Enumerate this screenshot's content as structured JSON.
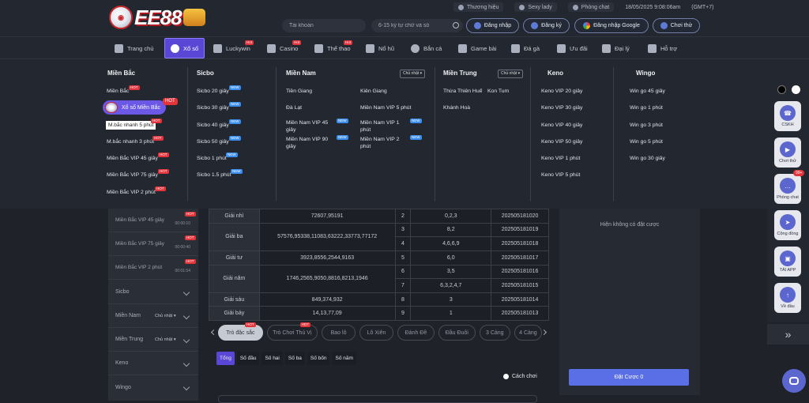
{
  "header": {
    "logo_text": "EE88",
    "top_links": [
      {
        "label": "Thương hiệu",
        "icon": "github-like-icon"
      },
      {
        "label": "Sexy lady",
        "icon": "lady-icon"
      },
      {
        "label": "Phòng chat",
        "icon": "chat-icon"
      }
    ],
    "datetime": "18/05/2025 9:08:06am",
    "timezone": "(GMT+7)",
    "account_placeholder": "Tài khoản",
    "password_placeholder": "6-15 ký tự chữ và số",
    "login_label": "Đăng nhập",
    "register_label": "Đăng ký",
    "google_login_label": "Đăng nhập Google",
    "trial_label": "Chơi thử"
  },
  "nav": {
    "items": [
      {
        "label": "Trang chủ",
        "icon": "home-icon"
      },
      {
        "label": "Xổ số",
        "icon": "lottery-icon"
      },
      {
        "label": "Luckywin",
        "icon": "luckywin-icon",
        "badge": "Hot"
      },
      {
        "label": "Casino",
        "icon": "casino-icon",
        "badge": "Hot"
      },
      {
        "label": "Thể thao",
        "icon": "sports-icon",
        "badge": "Hot"
      },
      {
        "label": "Nổ hũ",
        "icon": "slots-icon"
      },
      {
        "label": "Bắn cá",
        "icon": "fish-icon"
      },
      {
        "label": "Game bài",
        "icon": "cards-icon"
      },
      {
        "label": "Đá gà",
        "icon": "rooster-icon"
      },
      {
        "label": "Ưu đãi",
        "icon": "gift-icon"
      },
      {
        "label": "Đại lý",
        "icon": "agent-icon"
      },
      {
        "label": "Hỗ trợ",
        "icon": "support-icon"
      }
    ]
  },
  "dropdown": {
    "mien_bac": {
      "title": "Miền Bắc",
      "items": [
        "Miền Bắc",
        "Xổ số Miền Bắc",
        "M.bắc nhanh 5 phút",
        "M.bắc nhanh 3 phút",
        "Miền Bắc VIP 45 giây",
        "Miền Bắc VIP 75 giây",
        "Miền Bắc VIP 2 phút"
      ],
      "hot_label": "HOT"
    },
    "sicbo": {
      "title": "Sicbo",
      "items": [
        "Sicbo 20 giây",
        "Sicbo 30 giây",
        "Sicbo 40 giây",
        "Sicbo 50 giây",
        "Sicbo 1 phút",
        "Sicbo 1.5 phút"
      ],
      "new_label": "NEW"
    },
    "mien_nam": {
      "title": "Miền Nam",
      "select": "Chủ nhật",
      "items": [
        "Tiền Giang",
        "Kiên Giang",
        "Đà Lạt",
        "Miền Nam VIP 5 phút",
        "Miền Nam VIP 45 giây",
        "Miền Nam VIP 1 phút",
        "Miền Nam VIP 90 giây",
        "Miền Nam VIP 2 phút"
      ]
    },
    "mien_trung": {
      "title": "Miền Trung",
      "select": "Chủ nhật",
      "items": [
        "Thừa Thiên Huế",
        "Kon Tum",
        "Khánh Hoà"
      ]
    },
    "keno": {
      "title": "Keno",
      "items": [
        "Keno VIP 20 giây",
        "Keno VIP 30 giây",
        "Keno VIP 40 giây",
        "Keno VIP 50 giây",
        "Keno VIP 1 phút",
        "Keno VIP 5 phút"
      ]
    },
    "wingo": {
      "title": "Wingo",
      "items": [
        "Win go 45 giây",
        "Win go 1 phút",
        "Win go 3 phút",
        "Win go 5 phút",
        "Win go 30 giây"
      ]
    }
  },
  "left_panel": {
    "rows": [
      {
        "label": "Miền Bắc VIP 45 giây",
        "time": "00:00:10",
        "badge": "HOT"
      },
      {
        "label": "Miền Bắc VIP 75 giây",
        "time": "00:00:40",
        "badge": "HOT"
      },
      {
        "label": "Miền Bắc VIP 2 phút",
        "time": "00:01:54",
        "badge": "HOT"
      }
    ],
    "categories": [
      {
        "label": "Sicbo"
      },
      {
        "label": "Miền Nam",
        "select": "Chủ nhật"
      },
      {
        "label": "Miền Trung",
        "select": "Chủ nhật"
      },
      {
        "label": "Keno"
      },
      {
        "label": "Wingo"
      }
    ]
  },
  "results": {
    "rows": [
      {
        "prize": "Giải nhì",
        "value": "72607,95191",
        "num": "2",
        "tail": "0,2,3",
        "session": "202505181020"
      },
      {
        "prize": "Giải ba",
        "value": "57576,95338,11083,63222,33773,77172",
        "num": "3",
        "tail": "8,2",
        "session": "202505181019"
      },
      {
        "prize": "",
        "value": "",
        "num": "4",
        "tail": "4,6,6,9",
        "session": "202505181018"
      },
      {
        "prize": "Giải tư",
        "value": "3923,8556,2544,9163",
        "num": "5",
        "tail": "6,0",
        "session": "202505181017"
      },
      {
        "prize": "Giải năm",
        "value": "1746,2565,9050,8816,8213,1946",
        "num": "6",
        "tail": "3,5",
        "session": "202505181016"
      },
      {
        "prize": "",
        "value": "",
        "num": "7",
        "tail": "6,3,2,4,7",
        "session": "202505181015"
      },
      {
        "prize": "Giải sáu",
        "value": "849,374,932",
        "num": "8",
        "tail": "3",
        "session": "202505181014"
      },
      {
        "prize": "Giải bảy",
        "value": "14,13,77,09",
        "num": "9",
        "tail": "1",
        "session": "202505181013"
      }
    ]
  },
  "tabs": {
    "items": [
      "Trò đặc sắc",
      "Trò Chơi Thú Vị",
      "Bao lô",
      "Lô Xiên",
      "Đánh Đề",
      "Đầu Đuôi",
      "3 Càng",
      "4 Càng"
    ],
    "hot_label": "HOT"
  },
  "subtabs": [
    "Tổng",
    "Số đầu",
    "Số hai",
    "Số ba",
    "Số bốn",
    "Số năm"
  ],
  "howto_label": "Cách chơi",
  "bet_panel": {
    "empty_text": "Hiện không có đặt cược",
    "bet_button": "Đặt Cược 0"
  },
  "right_sidebar": {
    "items": [
      {
        "label": "CSKH",
        "icon": "headset-icon"
      },
      {
        "label": "Chơi thử",
        "icon": "play-icon"
      },
      {
        "label": "Phòng chat",
        "icon": "chat-bubble-icon",
        "badge": "99+"
      },
      {
        "label": "Cộng đồng",
        "icon": "telegram-icon"
      },
      {
        "label": "TẢI APP",
        "icon": "app-icon"
      },
      {
        "label": "Về đầu",
        "icon": "arrow-up-icon"
      }
    ]
  },
  "colors": {
    "accent": "#5a47d6",
    "hot": "#e3333b",
    "new": "#3a8ef0",
    "bg": "#1f2229"
  }
}
